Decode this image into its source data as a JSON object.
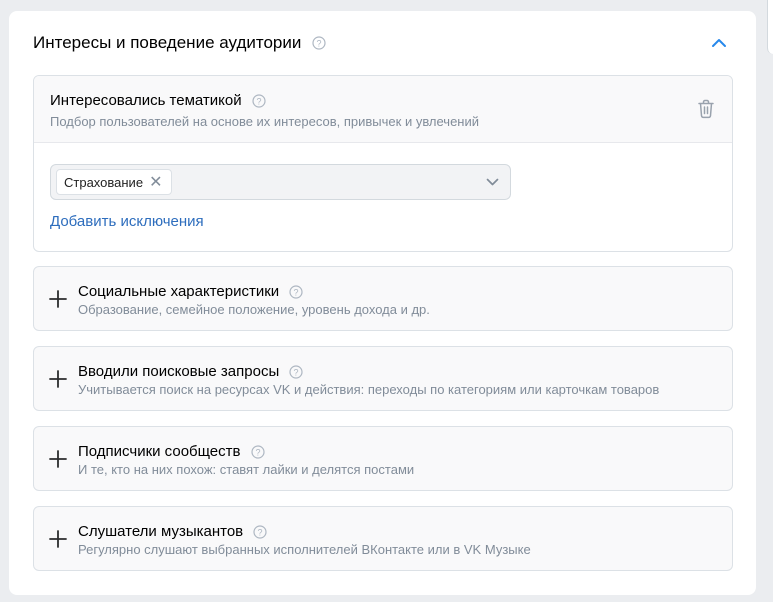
{
  "section": {
    "title": "Интересы и поведение аудитории"
  },
  "interests_block": {
    "title": "Интересовались тематикой",
    "description": "Подбор пользователей на основе их интересов, привычек и увлечений",
    "selected_chip": "Страхование",
    "remove_chip_glyph": "✕",
    "add_exclusions": "Добавить исключения"
  },
  "blocks": [
    {
      "title": "Социальные характеристики",
      "description": "Образование, семейное положение, уровень дохода и др."
    },
    {
      "title": "Вводили поисковые запросы",
      "description": "Учитывается поиск на ресурсах VK и действия: переходы по категориям или карточкам товаров"
    },
    {
      "title": "Подписчики сообществ",
      "description": "И те, кто на них похож: ставят лайки и делятся постами"
    },
    {
      "title": "Слушатели музыкантов",
      "description": "Регулярно слушают выбранных исполнителей ВКонтакте или в VK Музыке"
    }
  ],
  "icons": {
    "help": "question-circle-icon",
    "collapse": "chevron-up-icon",
    "delete": "trash-icon",
    "dropdown": "chevron-down-icon",
    "expand": "plus-icon"
  },
  "colors": {
    "link": "#2d6dbd",
    "accent": "#2688eb",
    "muted_text": "#818c99",
    "border": "#dce1e6"
  }
}
